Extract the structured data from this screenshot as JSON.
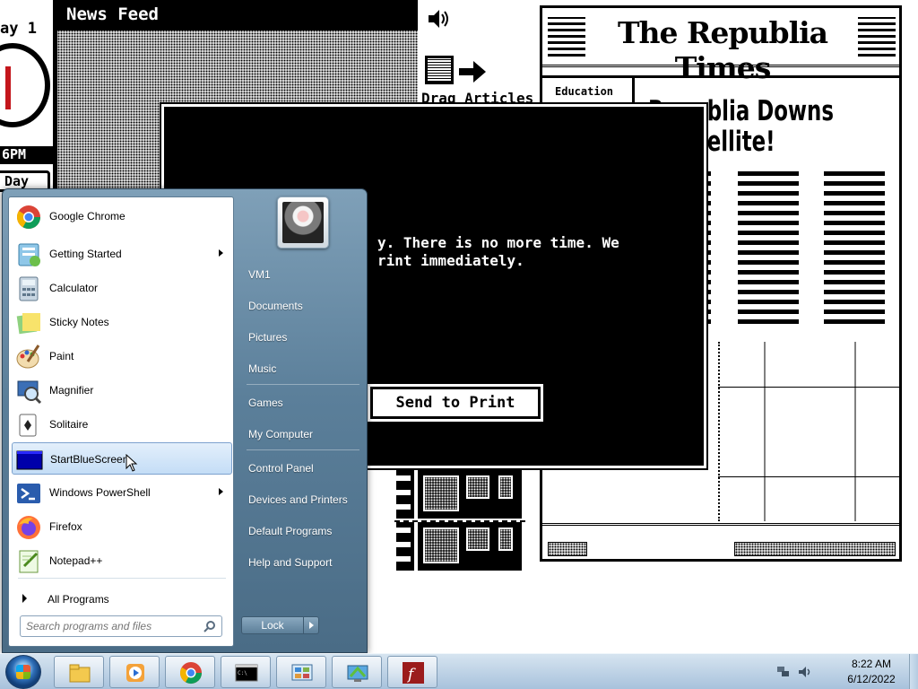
{
  "game": {
    "day_label": "ay 1",
    "time_label": "6PM",
    "day_button": "Day",
    "newsfeed_title": "News Feed",
    "drag_label": "Drag Articles",
    "newspaper": {
      "title": "The Republia Times",
      "section": "Education",
      "headline": "Republia Downs\ny Satellite!"
    },
    "dialog": {
      "message": "y. There is no more time. We\nrint immediately.",
      "button": "Send to Print"
    }
  },
  "start_menu": {
    "programs": [
      {
        "label": "Google Chrome",
        "icon": "chrome-icon",
        "submenu": false
      },
      {
        "label": "Getting Started",
        "icon": "getting-started-icon",
        "submenu": true
      },
      {
        "label": "Calculator",
        "icon": "calculator-icon",
        "submenu": false
      },
      {
        "label": "Sticky Notes",
        "icon": "sticky-notes-icon",
        "submenu": false
      },
      {
        "label": "Paint",
        "icon": "paint-icon",
        "submenu": false
      },
      {
        "label": "Magnifier",
        "icon": "magnifier-icon",
        "submenu": false
      },
      {
        "label": "Solitaire",
        "icon": "solitaire-icon",
        "submenu": false
      },
      {
        "label": "StartBlueScreen",
        "icon": "bluescreen-icon",
        "submenu": false,
        "highlighted": true
      },
      {
        "label": "Windows PowerShell",
        "icon": "powershell-icon",
        "submenu": true
      },
      {
        "label": "Firefox",
        "icon": "firefox-icon",
        "submenu": false
      },
      {
        "label": "Notepad++",
        "icon": "notepadpp-icon",
        "submenu": false
      }
    ],
    "all_programs": "All Programs",
    "search_placeholder": "Search programs and files",
    "right_items": {
      "user": "VM1",
      "documents": "Documents",
      "pictures": "Pictures",
      "music": "Music",
      "games": "Games",
      "my_computer": "My Computer",
      "control_panel": "Control Panel",
      "devices": "Devices and Printers",
      "default_programs": "Default Programs",
      "help": "Help and Support"
    },
    "lock_label": "Lock"
  },
  "taskbar": {
    "pinned": [
      "explorer-icon",
      "media-player-icon",
      "chrome-icon",
      "cmd-icon",
      "control-panel-icon",
      "remote-desktop-icon",
      "flash-icon"
    ],
    "time": "8:22 AM",
    "date": "6/12/2022"
  },
  "colors": {
    "accent_blue": "#5b7f9a",
    "highlight": "#c4ddf6",
    "bluescreen": "#0000aa"
  }
}
